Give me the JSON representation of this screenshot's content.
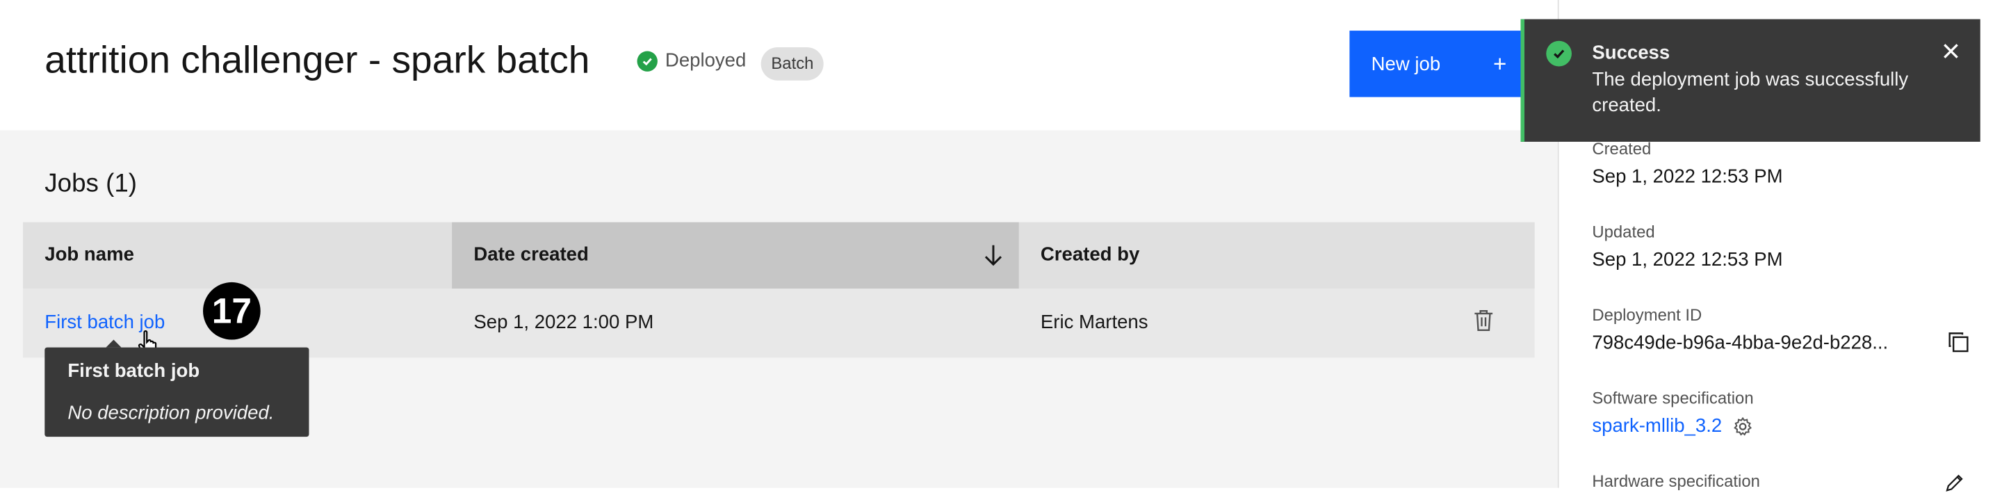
{
  "header": {
    "title": "attrition challenger - spark batch",
    "status_label": "Deployed",
    "tag_label": "Batch",
    "new_job_label": "New job",
    "new_job_icon": "+"
  },
  "jobs": {
    "title": "Jobs (1)",
    "columns": [
      "Job name",
      "Date created",
      "Created by"
    ],
    "sorted_column": "Date created",
    "sort_direction": "descending",
    "rows": [
      {
        "name": "First batch job",
        "date": "Sep 1, 2022 1:00 PM",
        "created_by": "Eric Martens"
      }
    ]
  },
  "tooltip": {
    "title": "First batch job",
    "description": "No description provided."
  },
  "step_badge": "17",
  "side_panel": {
    "created_label": "Created",
    "created_value": "Sep 1, 2022 12:53 PM",
    "updated_label": "Updated",
    "updated_value": "Sep 1, 2022 12:53 PM",
    "deployment_id_label": "Deployment ID",
    "deployment_id_value": "798c49de-b96a-4bba-9e2d-b228...",
    "software_spec_label": "Software specification",
    "software_spec_value": "spark-mllib_3.2",
    "hardware_spec_label": "Hardware specification"
  },
  "toast": {
    "title": "Success",
    "subtitle": "The deployment job was successfully created."
  },
  "colors": {
    "primary": "#0f62fe",
    "success": "#24a148",
    "toast_bg": "#393939"
  }
}
